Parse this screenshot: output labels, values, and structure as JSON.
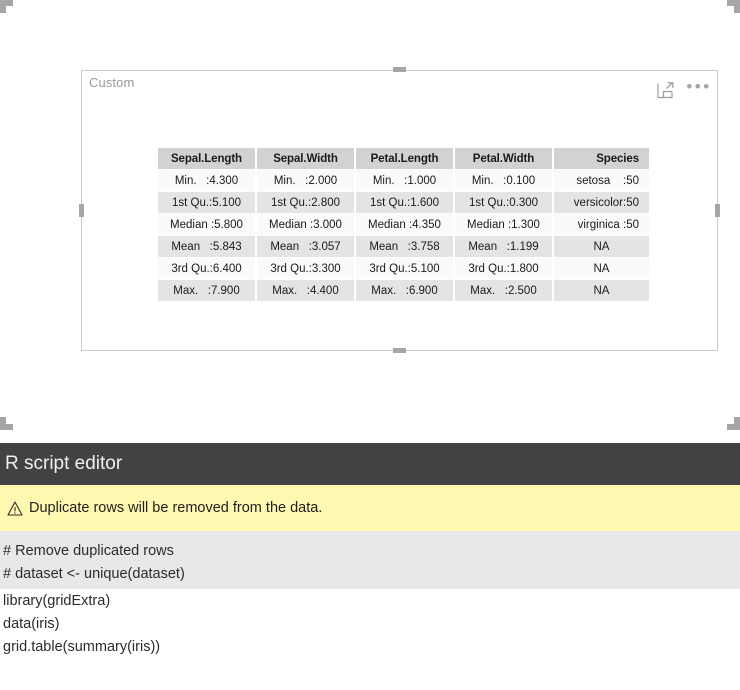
{
  "visual": {
    "title": "Custom",
    "icons": {
      "focus_mode": "focus-mode-icon",
      "more_options": "more-options-icon",
      "more_options_glyph": "•••"
    }
  },
  "table": {
    "headers": [
      "Sepal.Length",
      "Sepal.Width",
      "Petal.Length",
      "Petal.Width",
      "Species"
    ],
    "rows": [
      [
        "Min.   :4.300",
        "Min.   :2.000",
        "Min.   :1.000",
        "Min.   :0.100",
        "setosa    :50"
      ],
      [
        "1st Qu.:5.100",
        "1st Qu.:2.800",
        "1st Qu.:1.600",
        "1st Qu.:0.300",
        "versicolor:50"
      ],
      [
        "Median :5.800",
        "Median :3.000",
        "Median :4.350",
        "Median :1.300",
        "virginica :50"
      ],
      [
        "Mean   :5.843",
        "Mean   :3.057",
        "Mean   :3.758",
        "Mean   :1.199",
        "NA"
      ],
      [
        "3rd Qu.:6.400",
        "3rd Qu.:3.300",
        "3rd Qu.:5.100",
        "3rd Qu.:1.800",
        "NA"
      ],
      [
        "Max.   :7.900",
        "Max.   :4.400",
        "Max.   :6.900",
        "Max.   :2.500",
        "NA"
      ]
    ]
  },
  "editor": {
    "title": "R script editor",
    "warning": {
      "icon": "warning-triangle-icon",
      "text": "Duplicate rows will be removed from the data."
    },
    "code_readonly": [
      "# Remove duplicated rows",
      "# dataset <- unique(dataset)"
    ],
    "code_editable": [
      "library(gridExtra)",
      "data(iris)",
      "grid.table(summary(iris))"
    ]
  },
  "colors": {
    "editor_header_bg": "#424242",
    "warning_bg": "#fff8b0",
    "readonly_bg": "#e8e8e8",
    "table_header_bg": "#d2d2d2",
    "table_row_alt_bg": "#e4e4e4",
    "handle": "#a6a6a6"
  }
}
